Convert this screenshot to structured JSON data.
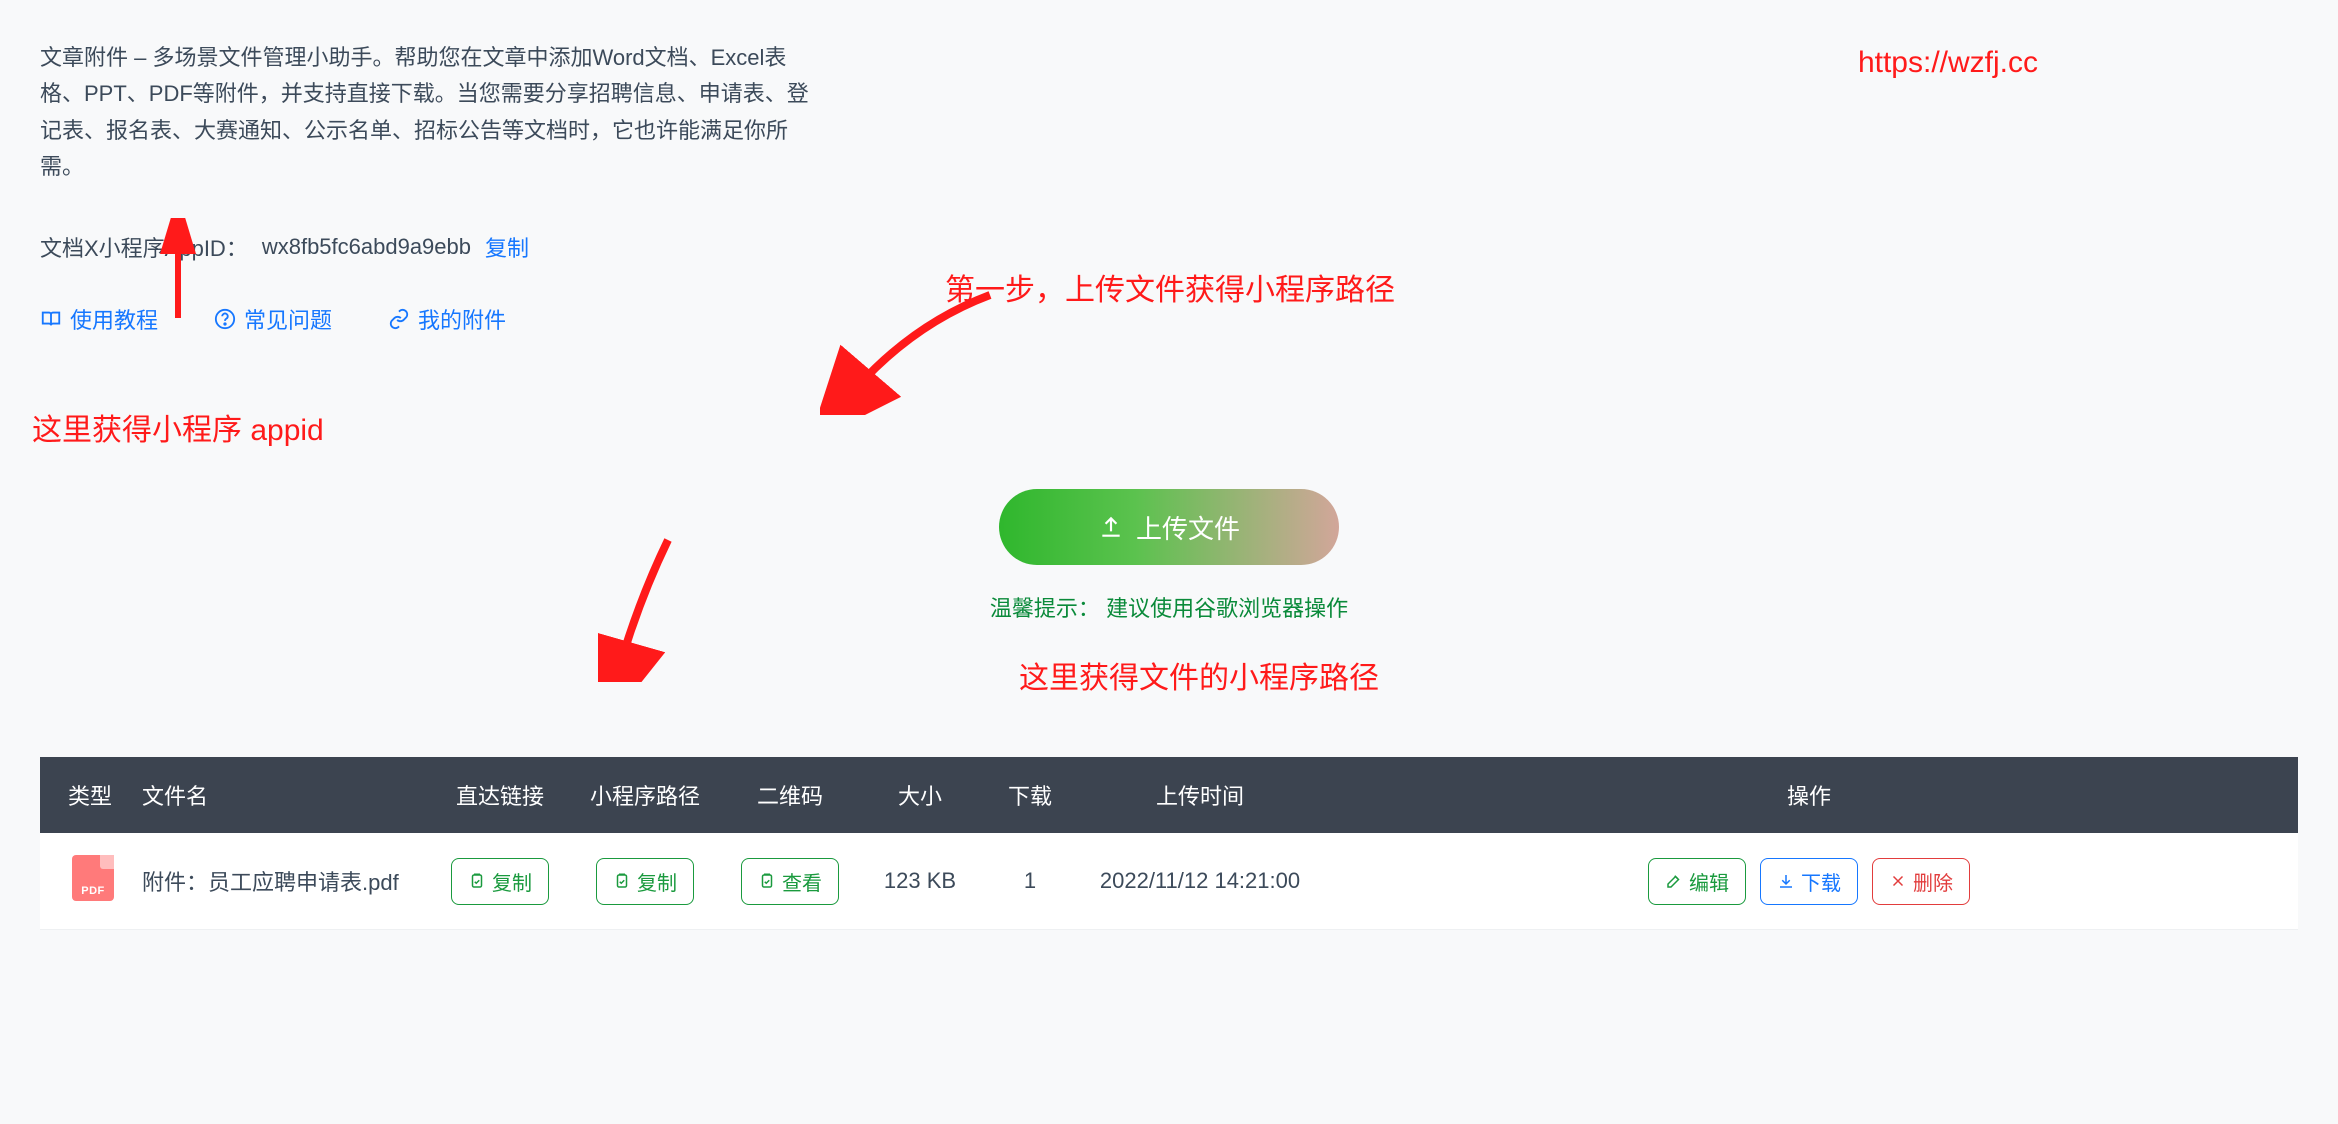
{
  "description": "文章附件 – 多场景文件管理小助手。帮助您在文章中添加Word文档、Excel表格、PPT、PDF等附件，并支持直接下载。当您需要分享招聘信息、申请表、登记表、报名表、大赛通知、公示名单、招标公告等文档时，它也许能满足你所需。",
  "url_annotation": "https://wzfj.cc",
  "appid_row": {
    "label": "文档X小程序AppID：",
    "value": "wx8fb5fc6abd9a9ebb",
    "copy": "复制"
  },
  "links": {
    "tutorial": "使用教程",
    "faq": "常见问题",
    "my_attachments": "我的附件"
  },
  "annotations": {
    "appid_here": "这里获得小程序 appid",
    "step1": "第一步，上传文件获得小程序路径",
    "path_here": "这里获得文件的小程序路径"
  },
  "upload": {
    "button": "上传文件",
    "tip_label": "温馨提示：",
    "tip_text": "建议使用谷歌浏览器操作"
  },
  "table": {
    "headers": {
      "type": "类型",
      "filename": "文件名",
      "direct_link": "直达链接",
      "mp_path": "小程序路径",
      "qrcode": "二维码",
      "size": "大小",
      "downloads": "下载",
      "upload_time": "上传时间",
      "ops": "操作"
    },
    "row": {
      "type_badge": "PDF",
      "filename": "附件：员工应聘申请表.pdf",
      "direct_link_btn": "复制",
      "mp_path_btn": "复制",
      "qrcode_btn": "查看",
      "size": "123 KB",
      "downloads": "1",
      "upload_time": "2022/11/12 14:21:00",
      "edit": "编辑",
      "download": "下载",
      "delete": "删除"
    }
  }
}
